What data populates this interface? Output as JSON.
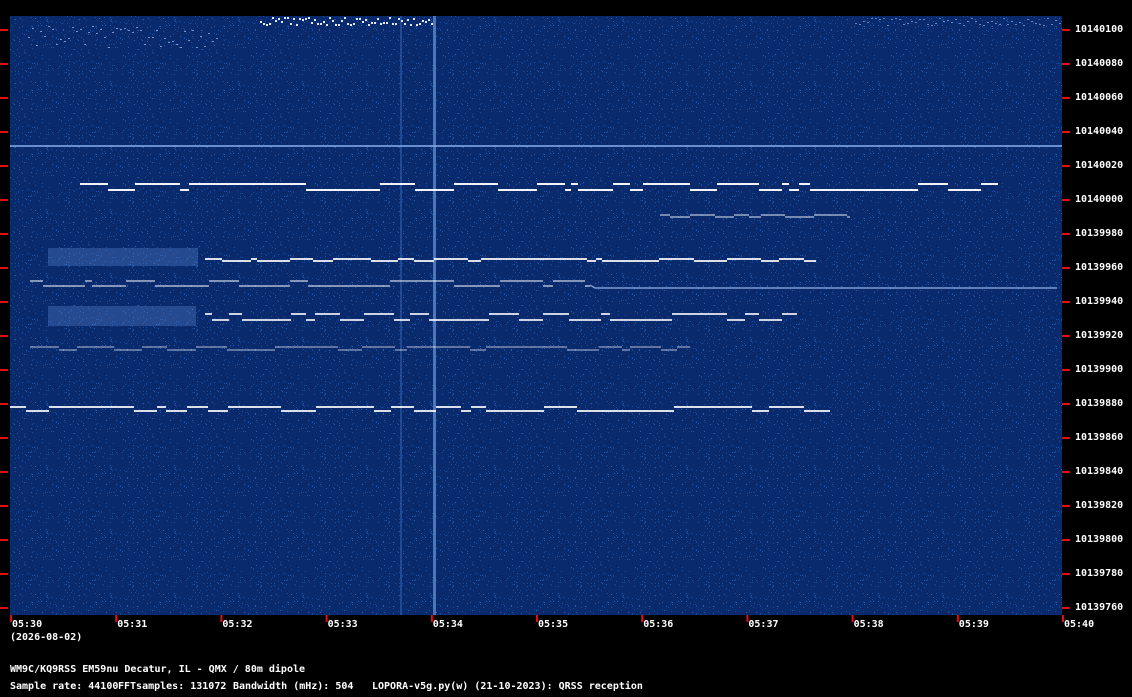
{
  "colors": {
    "background": "#000000",
    "waterfall_base": "#0a2a6e",
    "signal": "#ffffff",
    "tick_marks": "#e01010",
    "text": "#ffffff"
  },
  "frequency_axis": {
    "labels": [
      "10140100",
      "10140080",
      "10140060",
      "10140040",
      "10140020",
      "10140000",
      "10139980",
      "10139960",
      "10139940",
      "10139920",
      "10139900",
      "10139880",
      "10139860",
      "10139840",
      "10139820",
      "10139800",
      "10139780",
      "10139760"
    ]
  },
  "time_axis": {
    "labels": [
      "05:30",
      "05:31",
      "05:32",
      "05:33",
      "05:34",
      "05:35",
      "05:36",
      "05:37",
      "05:38",
      "05:39",
      "05:40"
    ],
    "date": "(2026-08-02)"
  },
  "footer": {
    "station": "WM9C/KQ9RSS EM59nu Decatur, IL - QMX / 80m dipole",
    "sample_rate": "Sample rate: 44100",
    "fft_samples": "FFTsamples: 131072",
    "bandwidth": "Bandwidth (mHz): 504",
    "software": "LOPORA-v5g.py(w) (21-10-2023): QRSS reception"
  }
}
